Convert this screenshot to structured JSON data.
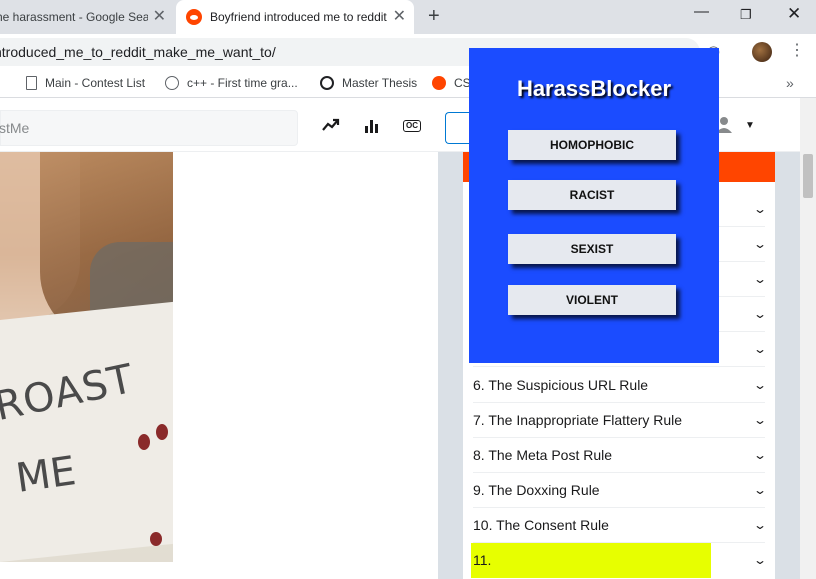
{
  "browser": {
    "tabs": [
      {
        "title": "he harassment - Google Sear",
        "close": "✕"
      },
      {
        "title": "Boyfriend introduced me to reddit",
        "close": "✕"
      }
    ],
    "new_tab": "+",
    "window_controls": {
      "minimize": "—",
      "maximize": "❐",
      "close": "✕"
    },
    "url": "ntroduced_me_to_reddit_make_me_want_to/",
    "bookmarks": [
      {
        "label": "Main - Contest List",
        "icon": "document-icon"
      },
      {
        "label": "c++ - First time gra...",
        "icon": "globe-icon"
      },
      {
        "label": "Master Thesis",
        "icon": "q-icon"
      },
      {
        "label": "CS",
        "icon": "reddit-icon"
      }
    ],
    "bookmarks_more": "»"
  },
  "reddit": {
    "search_placeholder": "stMe",
    "header_icons": [
      "trending-icon",
      "stats-icon",
      "oc-icon"
    ],
    "oc_label": "OC"
  },
  "photo_sign": {
    "line1": "ROAST",
    "line2": "ME"
  },
  "rules": [
    {
      "label": ""
    },
    {
      "label": ""
    },
    {
      "label": ""
    },
    {
      "label": ""
    },
    {
      "label": ""
    },
    {
      "label": "6. The Suspicious URL Rule"
    },
    {
      "label": "7. The Inappropriate Flattery Rule"
    },
    {
      "label": "8. The Meta Post Rule"
    },
    {
      "label": "9. The Doxxing Rule"
    },
    {
      "label": "10. The Consent Rule"
    },
    {
      "label": "11."
    }
  ],
  "colors": {
    "popup_bg": "#1b4cff",
    "highlight": "#e7ff00",
    "reddit_orange": "#ff4500"
  },
  "popup": {
    "title": "HarassBlocker",
    "buttons": [
      "HOMOPHOBIC",
      "RACIST",
      "SEXIST",
      "VIOLENT"
    ]
  }
}
